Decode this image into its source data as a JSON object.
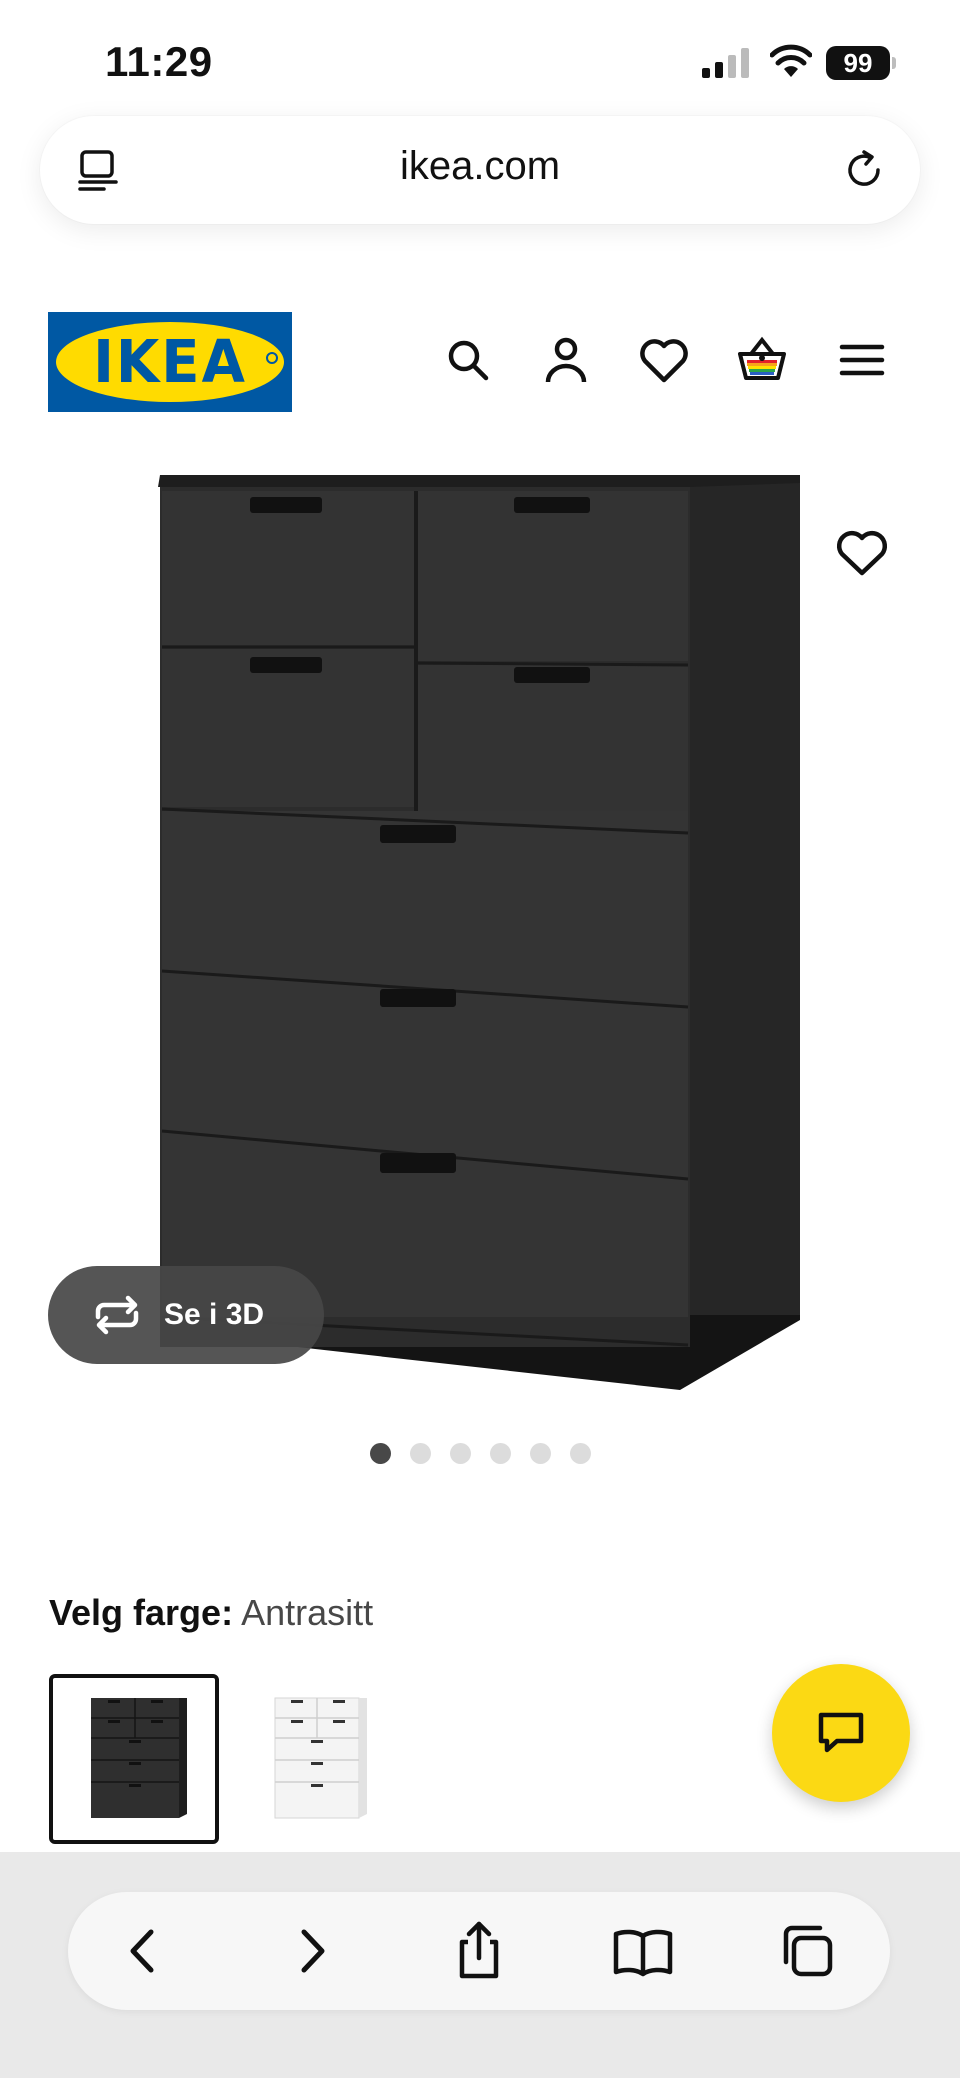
{
  "status_bar": {
    "time": "11:29",
    "battery": "99"
  },
  "browser": {
    "url": "ikea.com",
    "icons": [
      "reader-mode-icon",
      "reload-icon"
    ]
  },
  "site_header": {
    "logo_text": "IKEA",
    "brand_colors": {
      "blue": "#0058a3",
      "yellow": "#ffdb00"
    },
    "icons": [
      "search-icon",
      "account-icon",
      "wishlist-heart-icon",
      "shopping-basket-icon",
      "hamburger-menu-icon"
    ]
  },
  "product": {
    "image_alt": "drawer-chest-anthracite",
    "favorite_icon": "heart-icon",
    "see_3d_label": "Se i 3D",
    "carousel": {
      "count": 6,
      "active_index": 0
    }
  },
  "color_selection": {
    "label": "Velg farge:",
    "value": "Antrasitt",
    "swatches": [
      {
        "name": "anthracite",
        "selected": true,
        "color": "#2f2f2f"
      },
      {
        "name": "white",
        "selected": false,
        "color": "#f2f2f2"
      }
    ]
  },
  "chat": {
    "icon": "chat-bubble-icon",
    "color": "#fbd914"
  },
  "safari_toolbar": {
    "icons": [
      "back-icon",
      "forward-icon",
      "share-icon",
      "bookmarks-icon",
      "tabs-icon"
    ]
  }
}
